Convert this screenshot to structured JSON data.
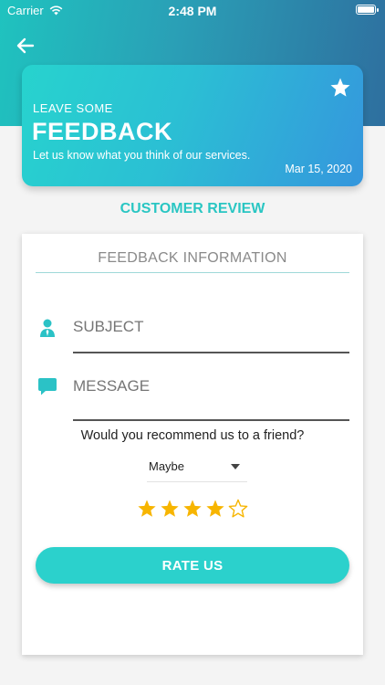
{
  "status_bar": {
    "carrier": "Carrier",
    "time": "2:48 PM",
    "battery_level": 1.0
  },
  "header": {
    "back_icon": "arrow-left-icon",
    "star_icon": "star-icon",
    "eyebrow": "LEAVE SOME",
    "title": "FEEDBACK",
    "subtitle": "Let us know what you think of our services.",
    "date": "Mar 15, 2020"
  },
  "section_title": "CUSTOMER REVIEW",
  "form": {
    "heading": "FEEDBACK INFORMATION",
    "subject": {
      "icon": "person-icon",
      "placeholder": "SUBJECT",
      "value": ""
    },
    "message": {
      "icon": "chat-bubble-icon",
      "placeholder": "MESSAGE",
      "value": ""
    },
    "recommend_question": "Would you recommend us to a friend?",
    "recommend_selected": "Maybe",
    "rating": {
      "value": 4,
      "max": 5
    },
    "submit_label": "RATE US"
  },
  "colors": {
    "accent": "#2bd1cc",
    "star_gold": "#f7b500",
    "header_gradient_start": "#27d3ce",
    "header_gradient_end": "#3596dd"
  }
}
